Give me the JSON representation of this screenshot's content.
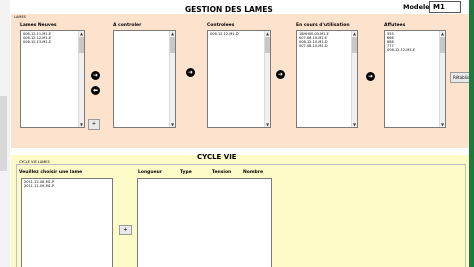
{
  "header": {
    "title": "GESTION DES LAMES",
    "model_label": "Modele",
    "model_value": "M1"
  },
  "lames_panel": {
    "caption": "LAMES",
    "lists": [
      {
        "header": "Lames Neuves",
        "items": [
          "006-12-11-M1-E",
          "006-12-12-M1-E",
          "006-12-13-M1-E"
        ]
      },
      {
        "header": "A controler",
        "items": []
      },
      {
        "header": "Controlees",
        "items": [
          "006-12-12-M1-D"
        ]
      },
      {
        "header": "En cours d'utilisation",
        "items": [
          "18HH00-00-M1-E",
          "007-08-10-M1-E",
          "006-12-10-M1-D",
          "007-08-10-M1-D"
        ]
      },
      {
        "header": "Affutees",
        "items": [
          "555",
          "666",
          "888",
          "777",
          "006-12-12-M1-E"
        ]
      }
    ],
    "arrow_buttons": [
      "arrow-right",
      "arrow-left",
      "arrow-right",
      "arrow-right",
      "arrow-right"
    ],
    "add_button": "+",
    "restore_button": "Rétablisser T"
  },
  "cycle_panel": {
    "caption": "CYCLE VIE LAMES",
    "title": "CYCLE VIE",
    "choose_label": "Veuillez choisir une lame",
    "lame_items": [
      "2011-12-08-M1-P",
      "2011-12-09-M1-P"
    ],
    "columns": [
      "Longueur",
      "Type",
      "Tension",
      "Nombre"
    ],
    "add_button": "+"
  },
  "colors": {
    "top_panel": "#fde3cd",
    "bottom_panel": "#fdfbc8",
    "right_edge": "#1e7a3c"
  }
}
